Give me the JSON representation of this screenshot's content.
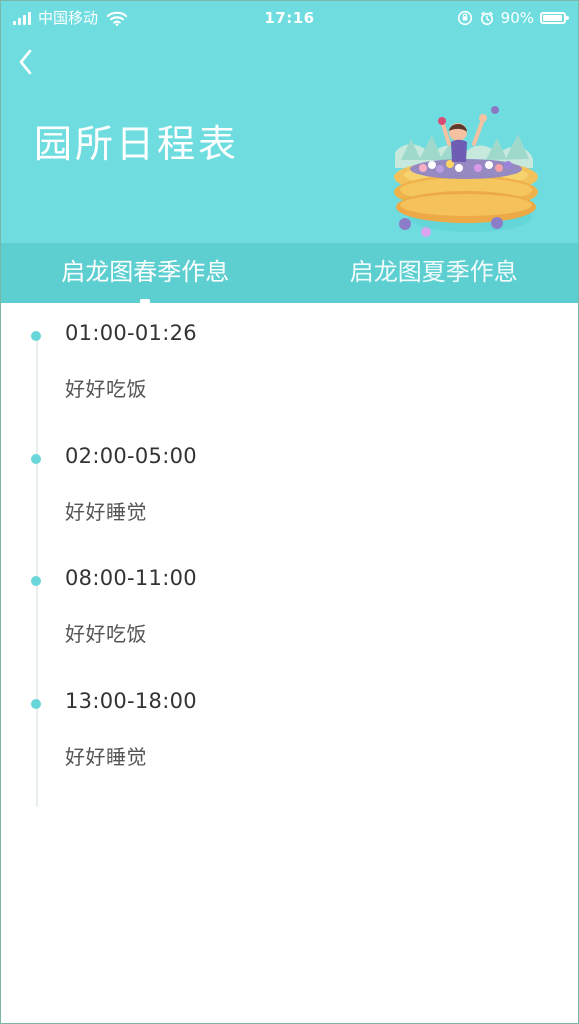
{
  "status_bar": {
    "carrier": "中国移动",
    "time": "17:16",
    "battery_percent": "90%",
    "icons": [
      "signal-icon",
      "wifi-icon",
      "orientation-lock-icon",
      "alarm-icon",
      "battery-icon"
    ]
  },
  "header": {
    "title": "园所日程表",
    "back_icon": "chevron-left-icon",
    "illustration": "child-in-ball-pool-illustration"
  },
  "tabs": [
    {
      "label": "启龙图春季作息",
      "selected": true
    },
    {
      "label": "启龙图夏季作息",
      "selected": false
    }
  ],
  "schedule": {
    "items": [
      {
        "time": "01:00-01:26",
        "activity": "好好吃饭"
      },
      {
        "time": "02:00-05:00",
        "activity": "好好睡觉"
      },
      {
        "time": "08:00-11:00",
        "activity": "好好吃饭"
      },
      {
        "time": "13:00-18:00",
        "activity": "好好睡觉"
      }
    ]
  },
  "colors": {
    "header_bg": "#6fdde0",
    "tab_bg": "#5dcfd1",
    "timeline_dot": "#69d6da",
    "timeline_line": "#e7eeee",
    "text_primary": "#333333",
    "text_secondary": "#555555"
  }
}
